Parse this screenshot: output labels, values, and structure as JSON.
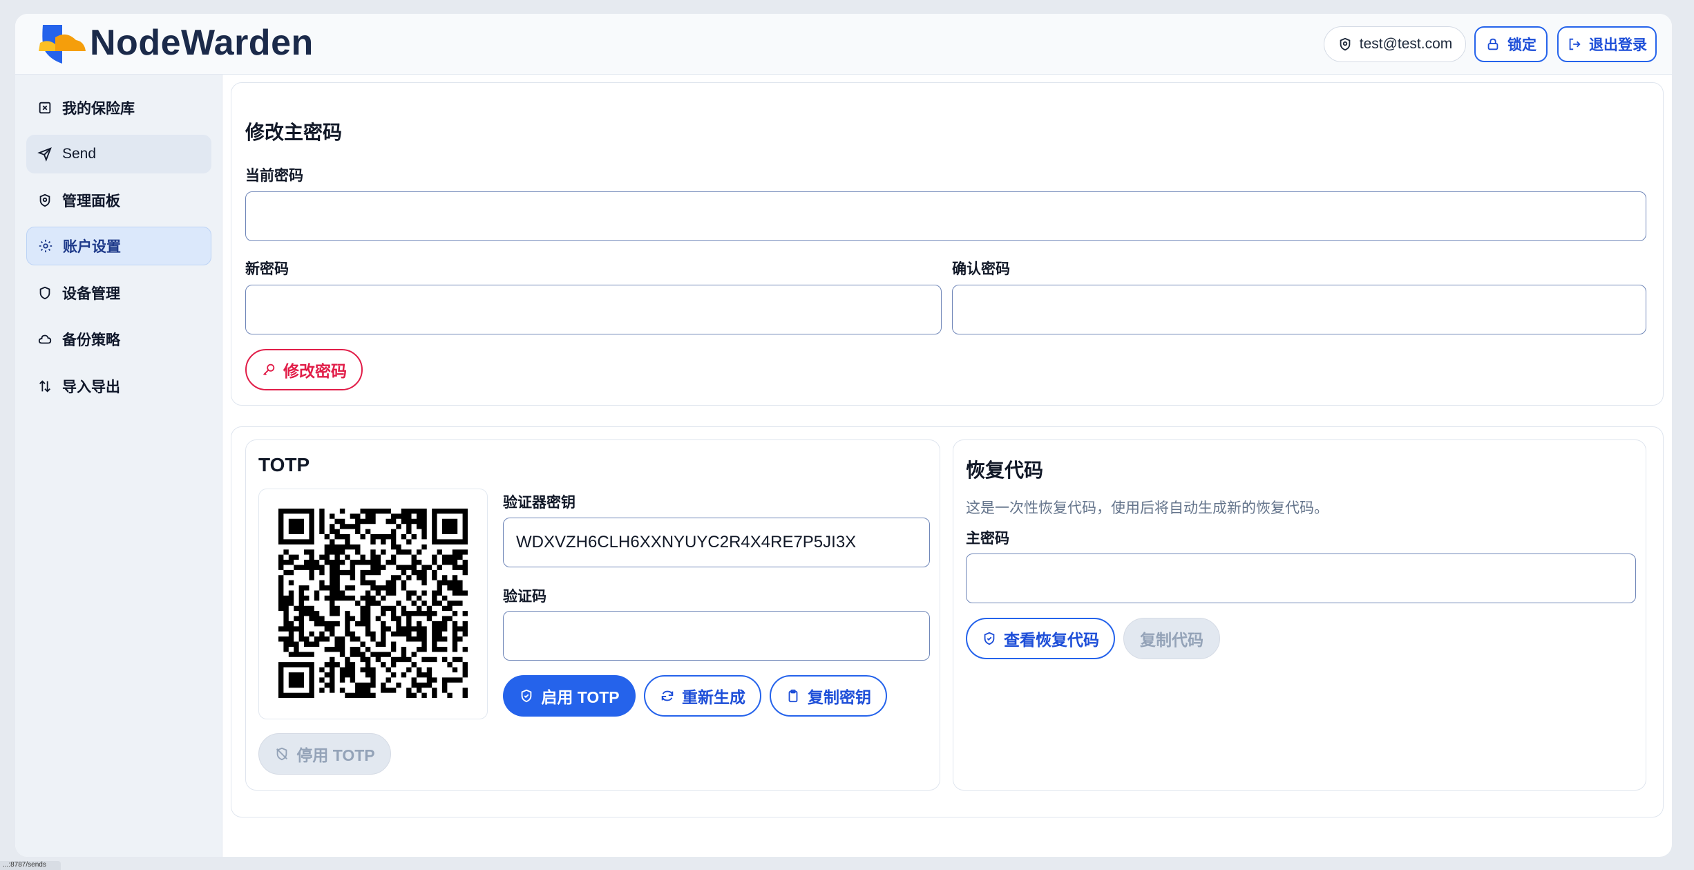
{
  "brand": {
    "name": "NodeWarden"
  },
  "header": {
    "user_email": "test@test.com",
    "lock_label": "锁定",
    "logout_label": "退出登录"
  },
  "sidebar": {
    "items": [
      {
        "label": "我的保险库",
        "icon": "vault-icon"
      },
      {
        "label": "Send",
        "icon": "send-icon"
      },
      {
        "label": "管理面板",
        "icon": "shield-gear-icon"
      },
      {
        "label": "账户设置",
        "icon": "gear-icon"
      },
      {
        "label": "设备管理",
        "icon": "shield-icon"
      },
      {
        "label": "备份策略",
        "icon": "cloud-icon"
      },
      {
        "label": "导入导出",
        "icon": "transfer-icon"
      }
    ]
  },
  "change_password": {
    "title": "修改主密码",
    "current_label": "当前密码",
    "new_label": "新密码",
    "confirm_label": "确认密码",
    "submit_label": "修改密码"
  },
  "totp": {
    "title": "TOTP",
    "secret_label": "验证器密钥",
    "secret_value": "WDXVZH6CLH6XXNYUYC2R4X4RE7P5JI3X",
    "code_label": "验证码",
    "enable_label": "启用 TOTP",
    "regenerate_label": "重新生成",
    "copy_label": "复制密钥",
    "disable_label": "停用 TOTP"
  },
  "recovery": {
    "title": "恢复代码",
    "hint": "这是一次性恢复代码，使用后将自动生成新的恢复代码。",
    "master_label": "主密码",
    "view_label": "查看恢复代码",
    "copy_label": "复制代码"
  },
  "statusbar": {
    "text": "...:8787/sends"
  },
  "colors": {
    "accent": "#2563eb",
    "danger": "#e11d48",
    "sidebar_bg": "#eef2f7"
  }
}
